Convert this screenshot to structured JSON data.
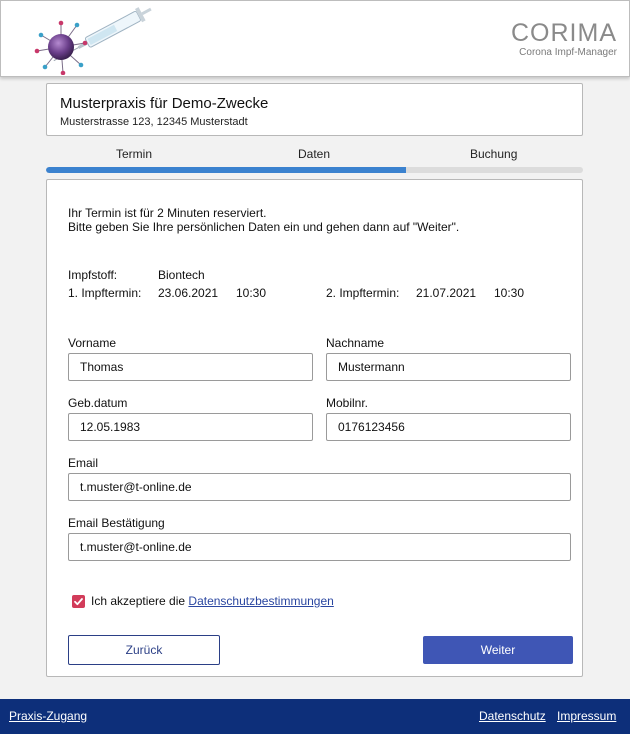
{
  "brand": {
    "title": "CORIMA",
    "subtitle": "Corona Impf-Manager"
  },
  "practice": {
    "name": "Musterpraxis für Demo-Zwecke",
    "address": "Musterstrasse 123, 12345 Musterstadt"
  },
  "steps": {
    "items": [
      "Termin",
      "Daten",
      "Buchung"
    ],
    "progress_percent": 67
  },
  "intro": {
    "line1": "Ihr Termin ist für 2 Minuten reserviert.",
    "line2": "Bitte geben Sie Ihre persönlichen Daten ein und gehen dann auf \"Weiter\"."
  },
  "vaccine": {
    "label": "Impfstoff:",
    "value": "Biontech",
    "first_label": "1. Impftermin:",
    "first_date": "23.06.2021",
    "first_time": "10:30",
    "second_label": "2. Impftermin:",
    "second_date": "21.07.2021",
    "second_time": "10:30"
  },
  "form": {
    "firstname_label": "Vorname",
    "firstname_value": "Thomas",
    "lastname_label": "Nachname",
    "lastname_value": "Mustermann",
    "birthdate_label": "Geb.datum",
    "birthdate_value": "12.05.1983",
    "mobile_label": "Mobilnr.",
    "mobile_value": "0176123456",
    "email_label": "Email",
    "email_value": "t.muster@t-online.de",
    "email_confirm_label": "Email Bestätigung",
    "email_confirm_value": "t.muster@t-online.de"
  },
  "consent": {
    "text": "Ich akzeptiere die",
    "link": "Datenschutzbestimmungen",
    "checked": true
  },
  "buttons": {
    "back": "Zurück",
    "next": "Weiter"
  },
  "footer": {
    "practice_access": "Praxis-Zugang",
    "privacy": "Datenschutz",
    "imprint": "Impressum"
  },
  "colors": {
    "accent": "#3f56b5",
    "progress": "#3b82cf",
    "footer": "#0d2f7a",
    "checkbox": "#d23c5a"
  }
}
